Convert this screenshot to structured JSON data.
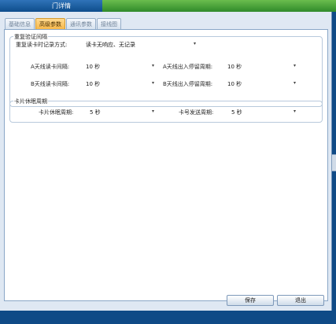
{
  "window": {
    "title": "门详情"
  },
  "tabs": [
    {
      "label": "基础信息"
    },
    {
      "label": "高级参数"
    },
    {
      "label": "通讯参数"
    },
    {
      "label": "接线图"
    }
  ],
  "verify_group": {
    "title": "重复验证间隔",
    "record_mode_label": "重复读卡时记录方式:",
    "record_mode_value": "读卡无响应、无记录",
    "a_interval_label": "A天线读卡间隔:",
    "a_interval_value": "10 秒",
    "a_stay_label": "A天线出入停留周期:",
    "a_stay_value": "10 秒",
    "b_interval_label": "B天线读卡间隔:",
    "b_interval_value": "10 秒",
    "b_stay_label": "B天线出入停留周期:",
    "b_stay_value": "10 秒"
  },
  "sleep_group": {
    "title": "卡片休眠周期",
    "sleep_label": "卡片休眠周期:",
    "sleep_value": "5 秒",
    "send_label": "卡号发送周期:",
    "send_value": "5 秒"
  },
  "buttons": {
    "save": "保存",
    "exit": "退出"
  },
  "colors": {
    "active_tab": "#f7b84a",
    "titlebar": "#0e4d8c",
    "green_strip": "#2f8a2a"
  }
}
